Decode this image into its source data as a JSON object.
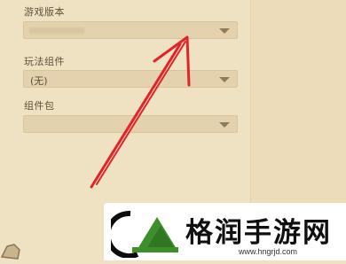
{
  "form": {
    "game_version": {
      "label": "游戏版本",
      "value": ""
    },
    "play_component": {
      "label": "玩法组件",
      "value": "(无)"
    },
    "component_pack": {
      "label": "组件包",
      "value": ""
    }
  },
  "watermark": {
    "name": "格润手游网",
    "url": "www.hngrjd.com"
  },
  "colors": {
    "background": "#efe2c2",
    "select_bg": "#e3d2ad",
    "arrow": "#e2242a",
    "logo_green": "#3c8f2a"
  },
  "icons": [
    "dropdown-chevron-icon",
    "red-arrow-annotation",
    "logo-emblem-icon",
    "corner-icon"
  ]
}
